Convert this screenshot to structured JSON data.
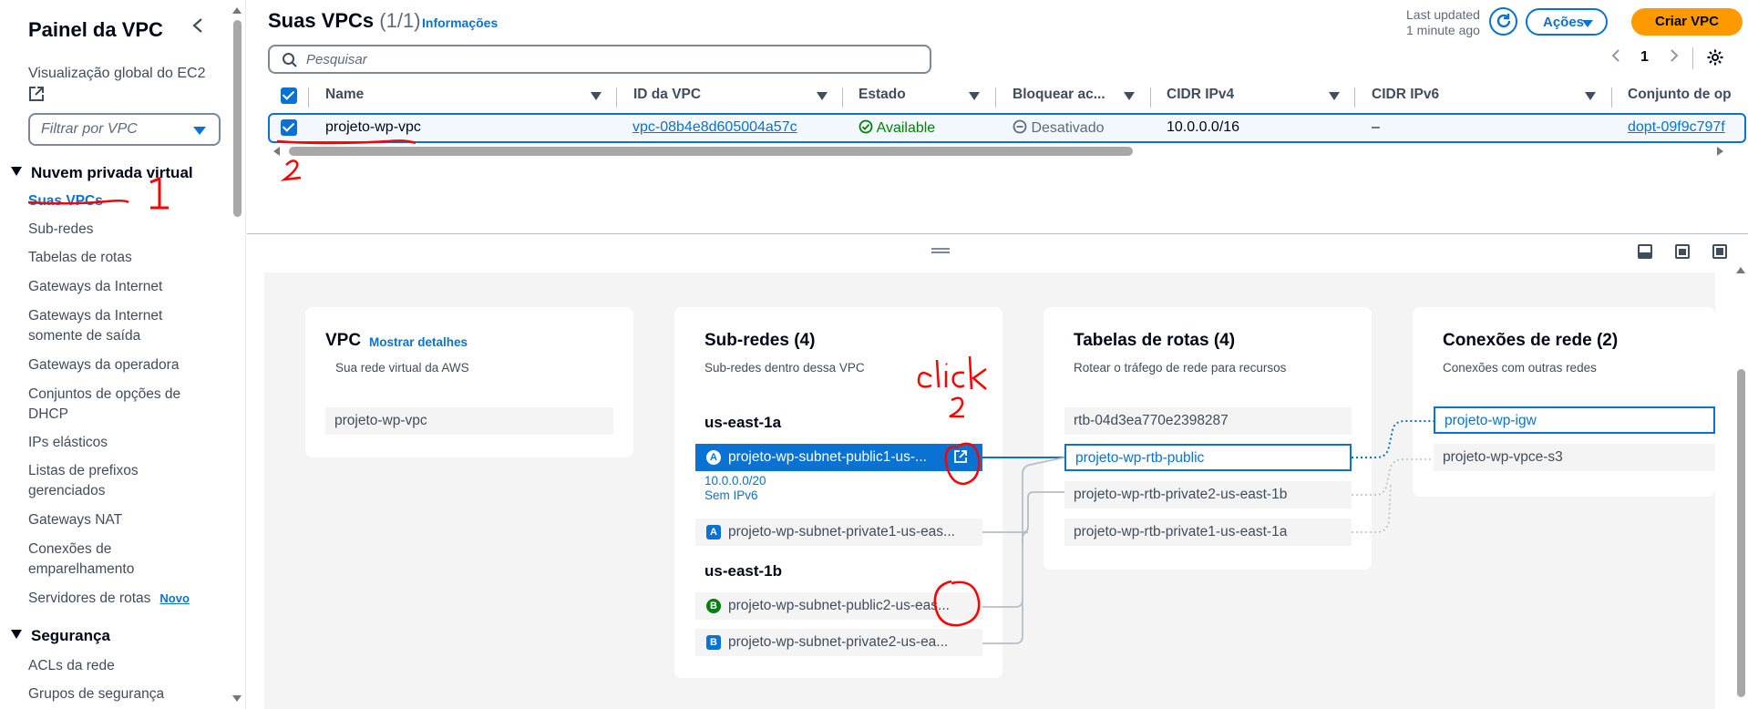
{
  "sidebar": {
    "title": "Painel da VPC",
    "global_view": "Visualização global do EC2",
    "filter_placeholder": "Filtrar por VPC",
    "section_vpc": "Nuvem privada virtual",
    "items": [
      {
        "label": "Suas VPCs"
      },
      {
        "label": "Sub-redes"
      },
      {
        "label": "Tabelas de rotas"
      },
      {
        "label": "Gateways da Internet"
      },
      {
        "label": "Gateways da Internet somente de saída"
      },
      {
        "label": "Gateways da operadora"
      },
      {
        "label": "Conjuntos de opções de DHCP"
      },
      {
        "label": "IPs elásticos"
      },
      {
        "label": "Listas de prefixos gerenciados"
      },
      {
        "label": "Gateways NAT"
      },
      {
        "label": "Conexões de emparelhamento"
      },
      {
        "label": "Servidores de rotas"
      }
    ],
    "new_badge": "Novo",
    "section_security": "Segurança",
    "security_items": [
      {
        "label": "ACLs da rede"
      },
      {
        "label": "Grupos de segurança"
      }
    ]
  },
  "header": {
    "title": "Suas VPCs",
    "count": "(1/1)",
    "info_link": "Informações",
    "last_updated_1": "Last updated",
    "last_updated_2": "1 minute ago",
    "actions_label": "Ações",
    "create_label": "Criar VPC",
    "search_placeholder": "Pesquisar",
    "page": "1"
  },
  "table": {
    "columns": [
      "Name",
      "ID da VPC",
      "Estado",
      "Bloquear ac...",
      "CIDR IPv4",
      "CIDR IPv6",
      "Conjunto de op"
    ],
    "rows": [
      {
        "name": "projeto-wp-vpc",
        "vpc_id": "vpc-08b4e8d605004a57c",
        "state": "Available",
        "block": "Desativado",
        "cidr_v4": "10.0.0.0/16",
        "cidr_v6": "–",
        "dhcp": "dopt-09f9c797f"
      }
    ]
  },
  "resource_map": {
    "vpc_card": {
      "title": "VPC",
      "details_link": "Mostrar detalhes",
      "subtitle": "Sua rede virtual da AWS",
      "name": "projeto-wp-vpc"
    },
    "subnets_card": {
      "title": "Sub-redes (4)",
      "subtitle": "Sub-redes dentro dessa VPC",
      "zones": [
        {
          "name": "us-east-1a",
          "subnets": [
            {
              "badge": "A",
              "label": "projeto-wp-subnet-public1-us-...",
              "cidr": "10.0.0.0/20",
              "ipv6": "Sem IPv6"
            },
            {
              "badge": "A",
              "label": "projeto-wp-subnet-private1-us-eas..."
            }
          ]
        },
        {
          "name": "us-east-1b",
          "subnets": [
            {
              "badge": "B",
              "label": "projeto-wp-subnet-public2-us-eas..."
            },
            {
              "badge": "B",
              "label": "projeto-wp-subnet-private2-us-ea..."
            }
          ]
        }
      ]
    },
    "routes_card": {
      "title": "Tabelas de rotas (4)",
      "subtitle": "Rotear o tráfego de rede para recursos",
      "items": [
        {
          "label": "rtb-04d3ea770e2398287"
        },
        {
          "label": "projeto-wp-rtb-public"
        },
        {
          "label": "projeto-wp-rtb-private2-us-east-1b"
        },
        {
          "label": "projeto-wp-rtb-private1-us-east-1a"
        }
      ]
    },
    "network_card": {
      "title": "Conexões de rede (2)",
      "subtitle": "Conexões com outras redes",
      "items": [
        {
          "label": "projeto-wp-igw"
        },
        {
          "label": "projeto-wp-vpce-s3"
        }
      ]
    }
  },
  "annotations": {
    "num1": "1",
    "num2": "2",
    "click": "click",
    "click_num": "2"
  },
  "colors": {
    "accent": "#0972d3",
    "primary_button": "#ff9900",
    "success": "#037f0c",
    "annotation": "#ff0000"
  }
}
